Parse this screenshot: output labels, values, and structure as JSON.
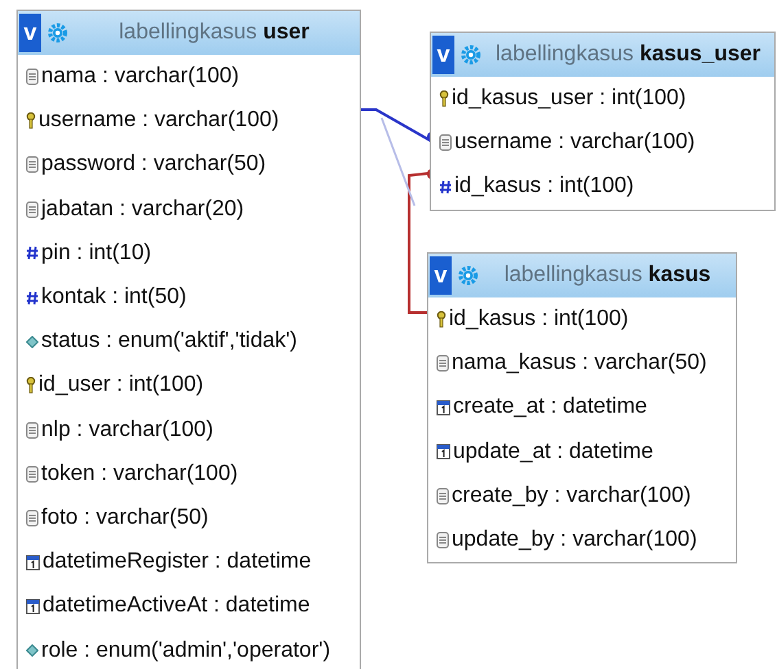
{
  "tables": [
    {
      "toggle": "v",
      "db": "labellingkasus",
      "name": "user",
      "fields": [
        {
          "kind": "text",
          "label": "nama : varchar(100)"
        },
        {
          "kind": "key",
          "label": "username : varchar(100)"
        },
        {
          "kind": "text",
          "label": "password : varchar(50)"
        },
        {
          "kind": "text",
          "label": "jabatan : varchar(20)"
        },
        {
          "kind": "number",
          "label": "pin : int(10)"
        },
        {
          "kind": "number",
          "label": "kontak : int(50)"
        },
        {
          "kind": "enum",
          "label": "status : enum('aktif','tidak')"
        },
        {
          "kind": "key",
          "label": "id_user : int(100)"
        },
        {
          "kind": "text",
          "label": "nlp : varchar(100)"
        },
        {
          "kind": "text",
          "label": "token : varchar(100)"
        },
        {
          "kind": "text",
          "label": "foto : varchar(50)"
        },
        {
          "kind": "date",
          "label": "datetimeRegister : datetime"
        },
        {
          "kind": "date",
          "label": "datetimeActiveAt : datetime"
        },
        {
          "kind": "enum",
          "label": "role : enum('admin','operator')"
        }
      ]
    },
    {
      "toggle": "v",
      "db": "labellingkasus",
      "name": "kasus_user",
      "fields": [
        {
          "kind": "key",
          "label": "id_kasus_user : int(100)"
        },
        {
          "kind": "text",
          "label": "username : varchar(100)"
        },
        {
          "kind": "number",
          "label": "id_kasus : int(100)"
        }
      ]
    },
    {
      "toggle": "v",
      "db": "labellingkasus",
      "name": "kasus",
      "fields": [
        {
          "kind": "key",
          "label": "id_kasus : int(100)"
        },
        {
          "kind": "text",
          "label": "nama_kasus : varchar(50)"
        },
        {
          "kind": "date",
          "label": "create_at : datetime"
        },
        {
          "kind": "date",
          "label": "update_at : datetime"
        },
        {
          "kind": "text",
          "label": "create_by : varchar(100)"
        },
        {
          "kind": "text",
          "label": "update_by : varchar(100)"
        }
      ]
    }
  ]
}
